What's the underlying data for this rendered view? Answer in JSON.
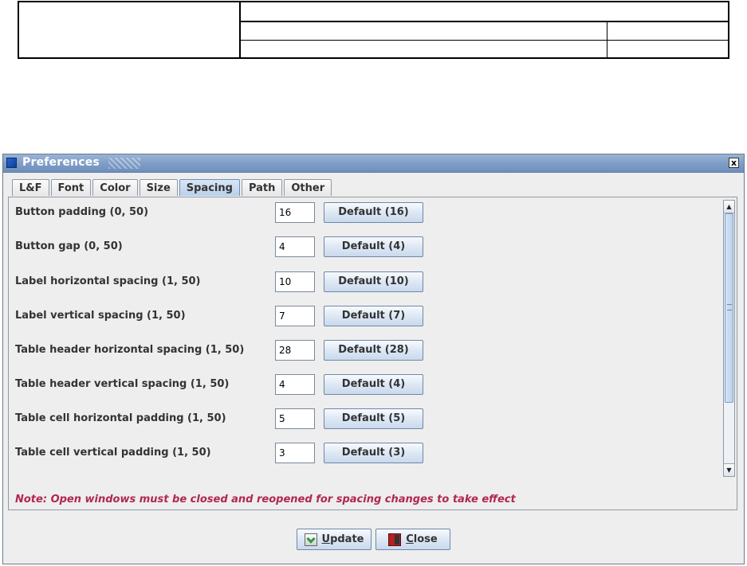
{
  "dialog": {
    "title": "Preferences",
    "close_symbol": "x",
    "tabs": [
      {
        "label": "L&F",
        "active": false
      },
      {
        "label": "Font",
        "active": false
      },
      {
        "label": "Color",
        "active": false
      },
      {
        "label": "Size",
        "active": false
      },
      {
        "label": "Spacing",
        "active": true
      },
      {
        "label": "Path",
        "active": false
      },
      {
        "label": "Other",
        "active": false
      }
    ],
    "rows": [
      {
        "label": "Button padding (0, 50)",
        "value": "16",
        "button": "Default (16)"
      },
      {
        "label": "Button gap (0, 50)",
        "value": "4",
        "button": "Default (4)"
      },
      {
        "label": "Label horizontal spacing (1, 50)",
        "value": "10",
        "button": "Default (10)"
      },
      {
        "label": "Label vertical spacing (1, 50)",
        "value": "7",
        "button": "Default (7)"
      },
      {
        "label": "Table header horizontal spacing (1, 50)",
        "value": "28",
        "button": "Default (28)"
      },
      {
        "label": "Table header vertical spacing (1, 50)",
        "value": "4",
        "button": "Default (4)"
      },
      {
        "label": "Table cell horizontal padding (1, 50)",
        "value": "5",
        "button": "Default (5)"
      },
      {
        "label": "Table cell vertical padding (1, 50)",
        "value": "3",
        "button": "Default (3)"
      }
    ],
    "note": "Note: Open windows must be closed and reopened for spacing changes to take effect",
    "buttons": {
      "update": {
        "mnemonic": "U",
        "rest": "pdate",
        "icon": "update-icon"
      },
      "close": {
        "mnemonic": "C",
        "rest": "lose",
        "icon": "exit-door-icon"
      }
    }
  },
  "colors": {
    "note": "#b0284f",
    "title_bar": "#7e9cc6",
    "active_tab": "#b9d0ea"
  }
}
